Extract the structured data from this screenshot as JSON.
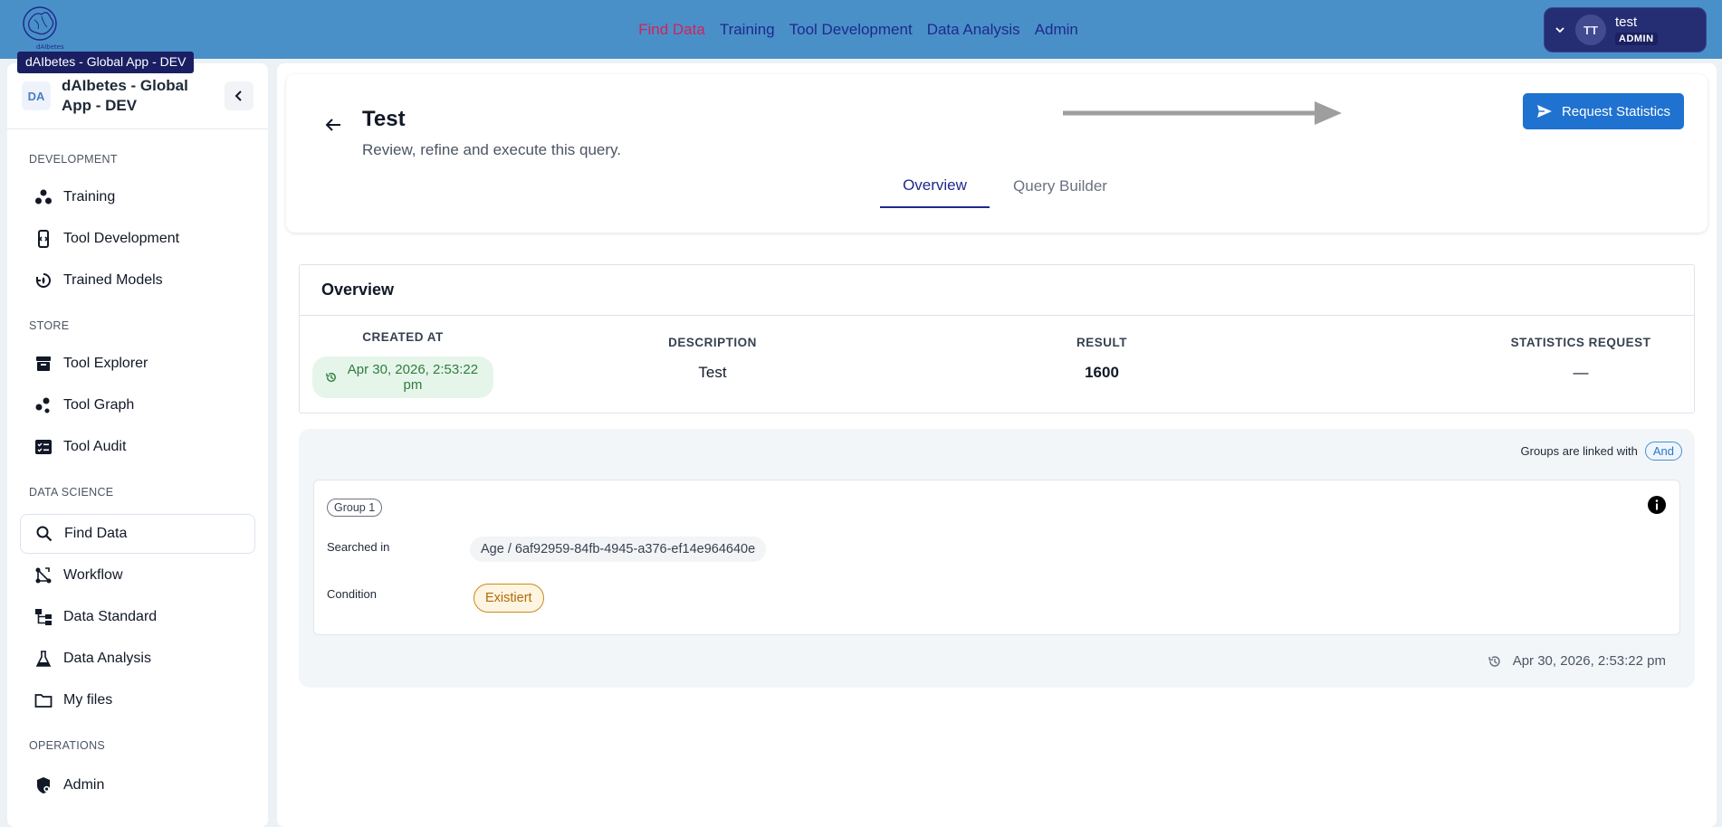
{
  "topbar": {
    "nav": [
      "Find Data",
      "Training",
      "Tool Development",
      "Data Analysis",
      "Admin"
    ],
    "active_nav": "Find Data",
    "user": {
      "initials": "TT",
      "name": "test",
      "role": "ADMIN"
    },
    "logo_text": "dAIbetes"
  },
  "tooltip": "dAIbetes - Global App - DEV",
  "sidebar": {
    "badge": "DA",
    "title": "dAIbetes - Global App - DEV",
    "sections": [
      {
        "label": "DEVELOPMENT",
        "items": [
          {
            "label": "Training",
            "icon": "training-icon"
          },
          {
            "label": "Tool Development",
            "icon": "tool-development-icon"
          },
          {
            "label": "Trained Models",
            "icon": "trained-models-icon"
          }
        ]
      },
      {
        "label": "STORE",
        "items": [
          {
            "label": "Tool Explorer",
            "icon": "archive-icon"
          },
          {
            "label": "Tool Graph",
            "icon": "graph-icon"
          },
          {
            "label": "Tool Audit",
            "icon": "audit-icon"
          }
        ]
      },
      {
        "label": "DATA SCIENCE",
        "items": [
          {
            "label": "Find Data",
            "icon": "search-icon"
          },
          {
            "label": "Workflow",
            "icon": "workflow-icon"
          },
          {
            "label": "Data Standard",
            "icon": "data-standard-icon"
          },
          {
            "label": "Data Analysis",
            "icon": "flask-icon"
          },
          {
            "label": "My files",
            "icon": "folder-icon"
          }
        ]
      },
      {
        "label": "OPERATIONS",
        "items": [
          {
            "label": "Admin",
            "icon": "admin-shield-icon"
          }
        ]
      }
    ],
    "active_item": "Find Data"
  },
  "header": {
    "title": "Test",
    "subtitle": "Review, refine and execute this query.",
    "request_button": "Request Statistics",
    "tabs": [
      "Overview",
      "Query Builder"
    ],
    "active_tab": "Overview"
  },
  "overview": {
    "title": "Overview",
    "columns": [
      "CREATED AT",
      "DESCRIPTION",
      "RESULT",
      "STATISTICS REQUEST"
    ],
    "values": {
      "created_at": "Apr 30, 2026, 2:53:22 pm",
      "description": "Test",
      "result": "1600",
      "statistics_request": "—"
    }
  },
  "groups": {
    "linked_label": "Groups are linked with",
    "linked_value": "And",
    "group_name": "Group 1",
    "searched_in_label": "Searched in",
    "searched_in_value": "Age / 6af92959-84fb-4945-a376-ef14e964640e",
    "condition_label": "Condition",
    "condition_value": "Existiert",
    "timestamp": "Apr 30, 2026, 2:53:22 pm"
  },
  "colors": {
    "topbar": "#4a90c8",
    "nav_link": "#1e2a8c",
    "nav_active": "#d0225e",
    "primary_button": "#1f72d0",
    "date_pill_bg": "#e5f5ea",
    "condition_border": "#c98a16"
  }
}
